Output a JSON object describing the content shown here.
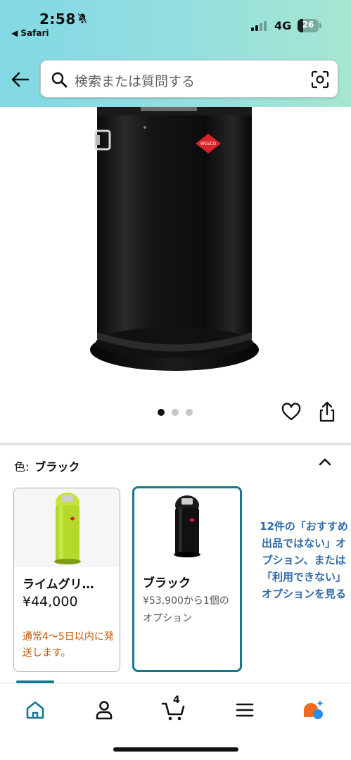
{
  "status_bar": {
    "time": "2:58",
    "back_app": "◀ Safari",
    "network": "4G",
    "battery": "26",
    "battery_level": 0.26
  },
  "header": {
    "search_placeholder": "検索または質問する"
  },
  "carousel": {
    "count": 3,
    "active_index": 0
  },
  "variation": {
    "label": "色:",
    "selected": "ブラック"
  },
  "swatches": [
    {
      "name": "ライムグリ…",
      "price": "¥44,000",
      "note": "通常4～5日以内に発送します。"
    },
    {
      "name": "ブラック",
      "price_line": "¥53,900から1個のオプション"
    }
  ],
  "more_options": "12件の「おすすめ出品ではない」オプション、または「利用できない」オプションを見る",
  "bottom_nav": {
    "cart_count": "4",
    "active": "home"
  },
  "colors": {
    "header_gradient_start": "#82d8e3",
    "header_gradient_end": "#a6e6d2",
    "selected_border": "#137a8c",
    "link": "#2f6ba5",
    "shipping_note": "#c45500",
    "lime": "#b5d92a"
  }
}
